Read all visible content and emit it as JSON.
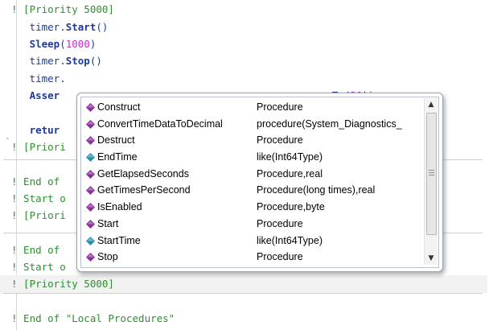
{
  "editor": {
    "lines": [
      {
        "segments": [
          {
            "t": "! [Priority 5000]",
            "c": "c-comment"
          }
        ]
      },
      {
        "segments": [
          {
            "t": "   timer.",
            "c": "c-plain"
          },
          {
            "t": "Start",
            "c": "c-kw"
          },
          {
            "t": "()",
            "c": "c-plain"
          }
        ]
      },
      {
        "segments": [
          {
            "t": "   Sleep",
            "c": "c-kw"
          },
          {
            "t": "(",
            "c": "c-plain"
          },
          {
            "t": "1000",
            "c": "c-num"
          },
          {
            "t": ")",
            "c": "c-plain"
          }
        ]
      },
      {
        "segments": [
          {
            "t": "   timer.",
            "c": "c-plain"
          },
          {
            "t": "Stop",
            "c": "c-kw"
          },
          {
            "t": "()",
            "c": "c-plain"
          }
        ]
      },
      {
        "segments": [
          {
            "t": "   timer.",
            "c": "c-plain"
          }
        ]
      },
      {
        "segments": [
          {
            "t": "   Asser",
            "c": "c-kw"
          },
          {
            "t": "                                             ",
            "c": "c-plain"
          },
          {
            "t": "To",
            "c": "c-plain"
          },
          {
            "t": "(",
            "c": "c-plain"
          },
          {
            "t": "20",
            "c": "c-num"
          },
          {
            "t": "))",
            "c": "c-plain"
          }
        ]
      },
      {
        "segments": [
          {
            "t": "",
            "c": "c-plain"
          }
        ]
      },
      {
        "segments": [
          {
            "t": "   retur",
            "c": "c-kw"
          }
        ]
      },
      {
        "segments": [
          {
            "t": "! [Priori",
            "c": "c-comment"
          }
        ]
      },
      {
        "segments": [
          {
            "t": "",
            "c": "c-plain"
          }
        ]
      },
      {
        "segments": [
          {
            "t": "! End of",
            "c": "c-comment"
          }
        ]
      },
      {
        "segments": [
          {
            "t": "! Start o",
            "c": "c-comment"
          }
        ]
      },
      {
        "segments": [
          {
            "t": "! [Priori",
            "c": "c-comment"
          }
        ]
      },
      {
        "segments": [
          {
            "t": "",
            "c": "c-plain"
          }
        ]
      },
      {
        "segments": [
          {
            "t": "! End of",
            "c": "c-comment"
          }
        ]
      },
      {
        "segments": [
          {
            "t": "! Start o",
            "c": "c-comment"
          }
        ]
      },
      {
        "segments": [
          {
            "t": "! [Priority 5000]",
            "c": "c-comment"
          }
        ]
      },
      {
        "segments": [
          {
            "t": "",
            "c": "c-plain"
          }
        ]
      },
      {
        "segments": [
          {
            "t": "! End of \"Local Procedures\"",
            "c": "c-comment"
          }
        ]
      }
    ]
  },
  "autocomplete": {
    "items": [
      {
        "name": "Construct",
        "type": "Procedure",
        "icon": "method-icon",
        "color": "#8b2f9b"
      },
      {
        "name": "ConvertTimeDataToDecimal",
        "type": "procedure(System_Diagnostics_",
        "icon": "method-icon",
        "color": "#8b2f9b"
      },
      {
        "name": "Destruct",
        "type": "Procedure",
        "icon": "method-icon",
        "color": "#8b2f9b"
      },
      {
        "name": "EndTime",
        "type": "like(Int64Type)",
        "icon": "property-icon",
        "color": "#2f8fa8"
      },
      {
        "name": "GetElapsedSeconds",
        "type": "Procedure,real",
        "icon": "method-icon",
        "color": "#8b2f9b"
      },
      {
        "name": "GetTimesPerSecond",
        "type": "Procedure(long times),real",
        "icon": "method-icon",
        "color": "#8b2f9b"
      },
      {
        "name": "IsEnabled",
        "type": "Procedure,byte",
        "icon": "method-icon",
        "color": "#8b2f9b"
      },
      {
        "name": "Start",
        "type": "Procedure",
        "icon": "method-icon",
        "color": "#8b2f9b"
      },
      {
        "name": "StartTime",
        "type": "like(Int64Type)",
        "icon": "property-icon",
        "color": "#2f8fa8"
      },
      {
        "name": "Stop",
        "type": "Procedure",
        "icon": "method-icon",
        "color": "#8b2f9b"
      }
    ],
    "scroll_up": "▲",
    "scroll_down": "▼"
  },
  "gutter": {
    "mark": "-"
  }
}
